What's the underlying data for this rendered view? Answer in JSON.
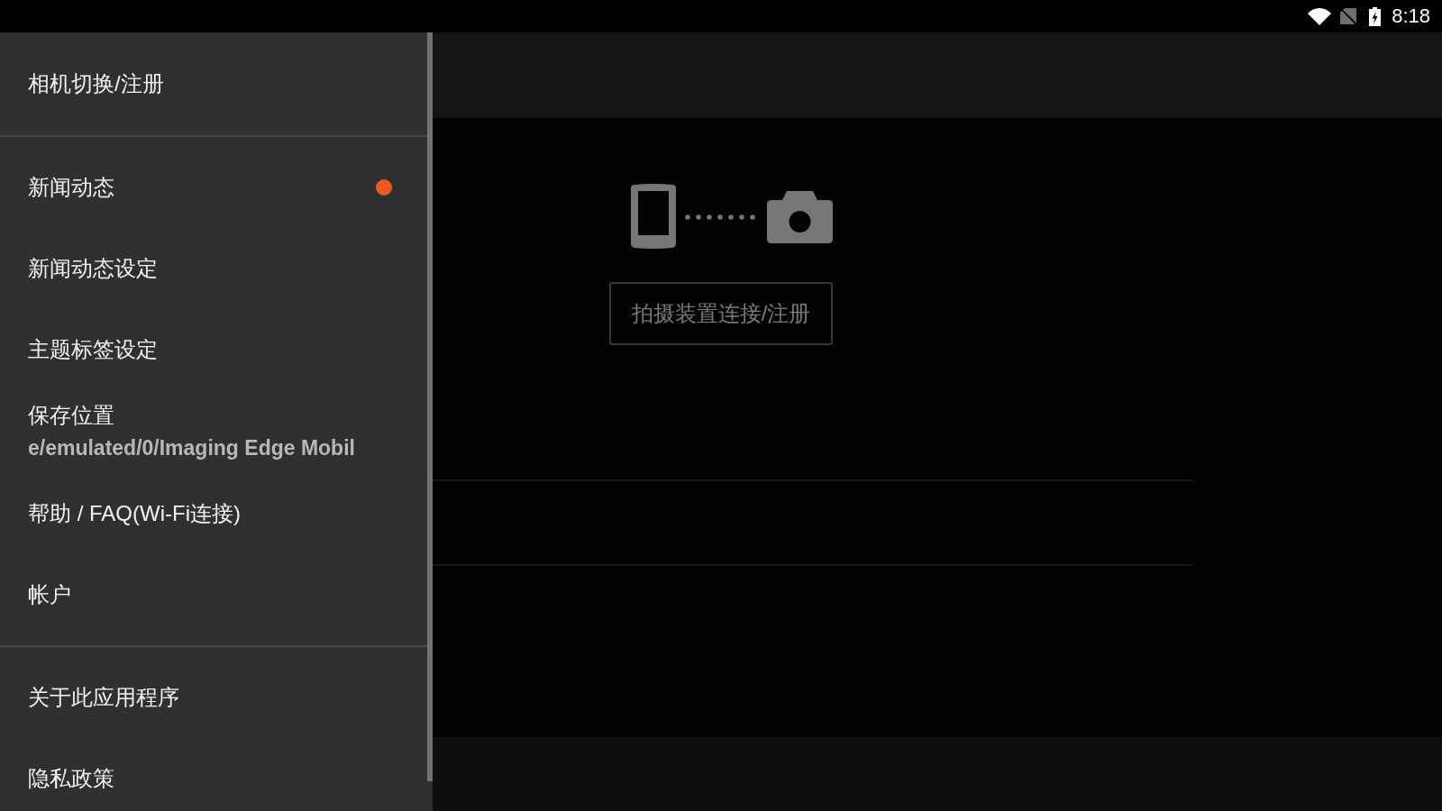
{
  "status_bar": {
    "time": "8:18"
  },
  "drawer": {
    "sections": [
      {
        "items": [
          {
            "label": "相机切换/注册",
            "unread": false
          }
        ]
      },
      {
        "items": [
          {
            "label": "新闻动态",
            "unread": true
          },
          {
            "label": "新闻动态设定",
            "unread": false
          },
          {
            "label": "主题标签设定",
            "unread": false
          },
          {
            "label": "保存位置",
            "unread": false,
            "value": "e/emulated/0/Imaging Edge Mobil"
          },
          {
            "label": "帮助 / FAQ(Wi-Fi连接)",
            "unread": false
          },
          {
            "label": "帐户",
            "unread": false
          }
        ]
      },
      {
        "items": [
          {
            "label": "关于此应用程序",
            "unread": false
          },
          {
            "label": "隐私政策",
            "unread": false
          }
        ]
      }
    ]
  },
  "main": {
    "connect_button": "拍摄装置连接/注册"
  }
}
